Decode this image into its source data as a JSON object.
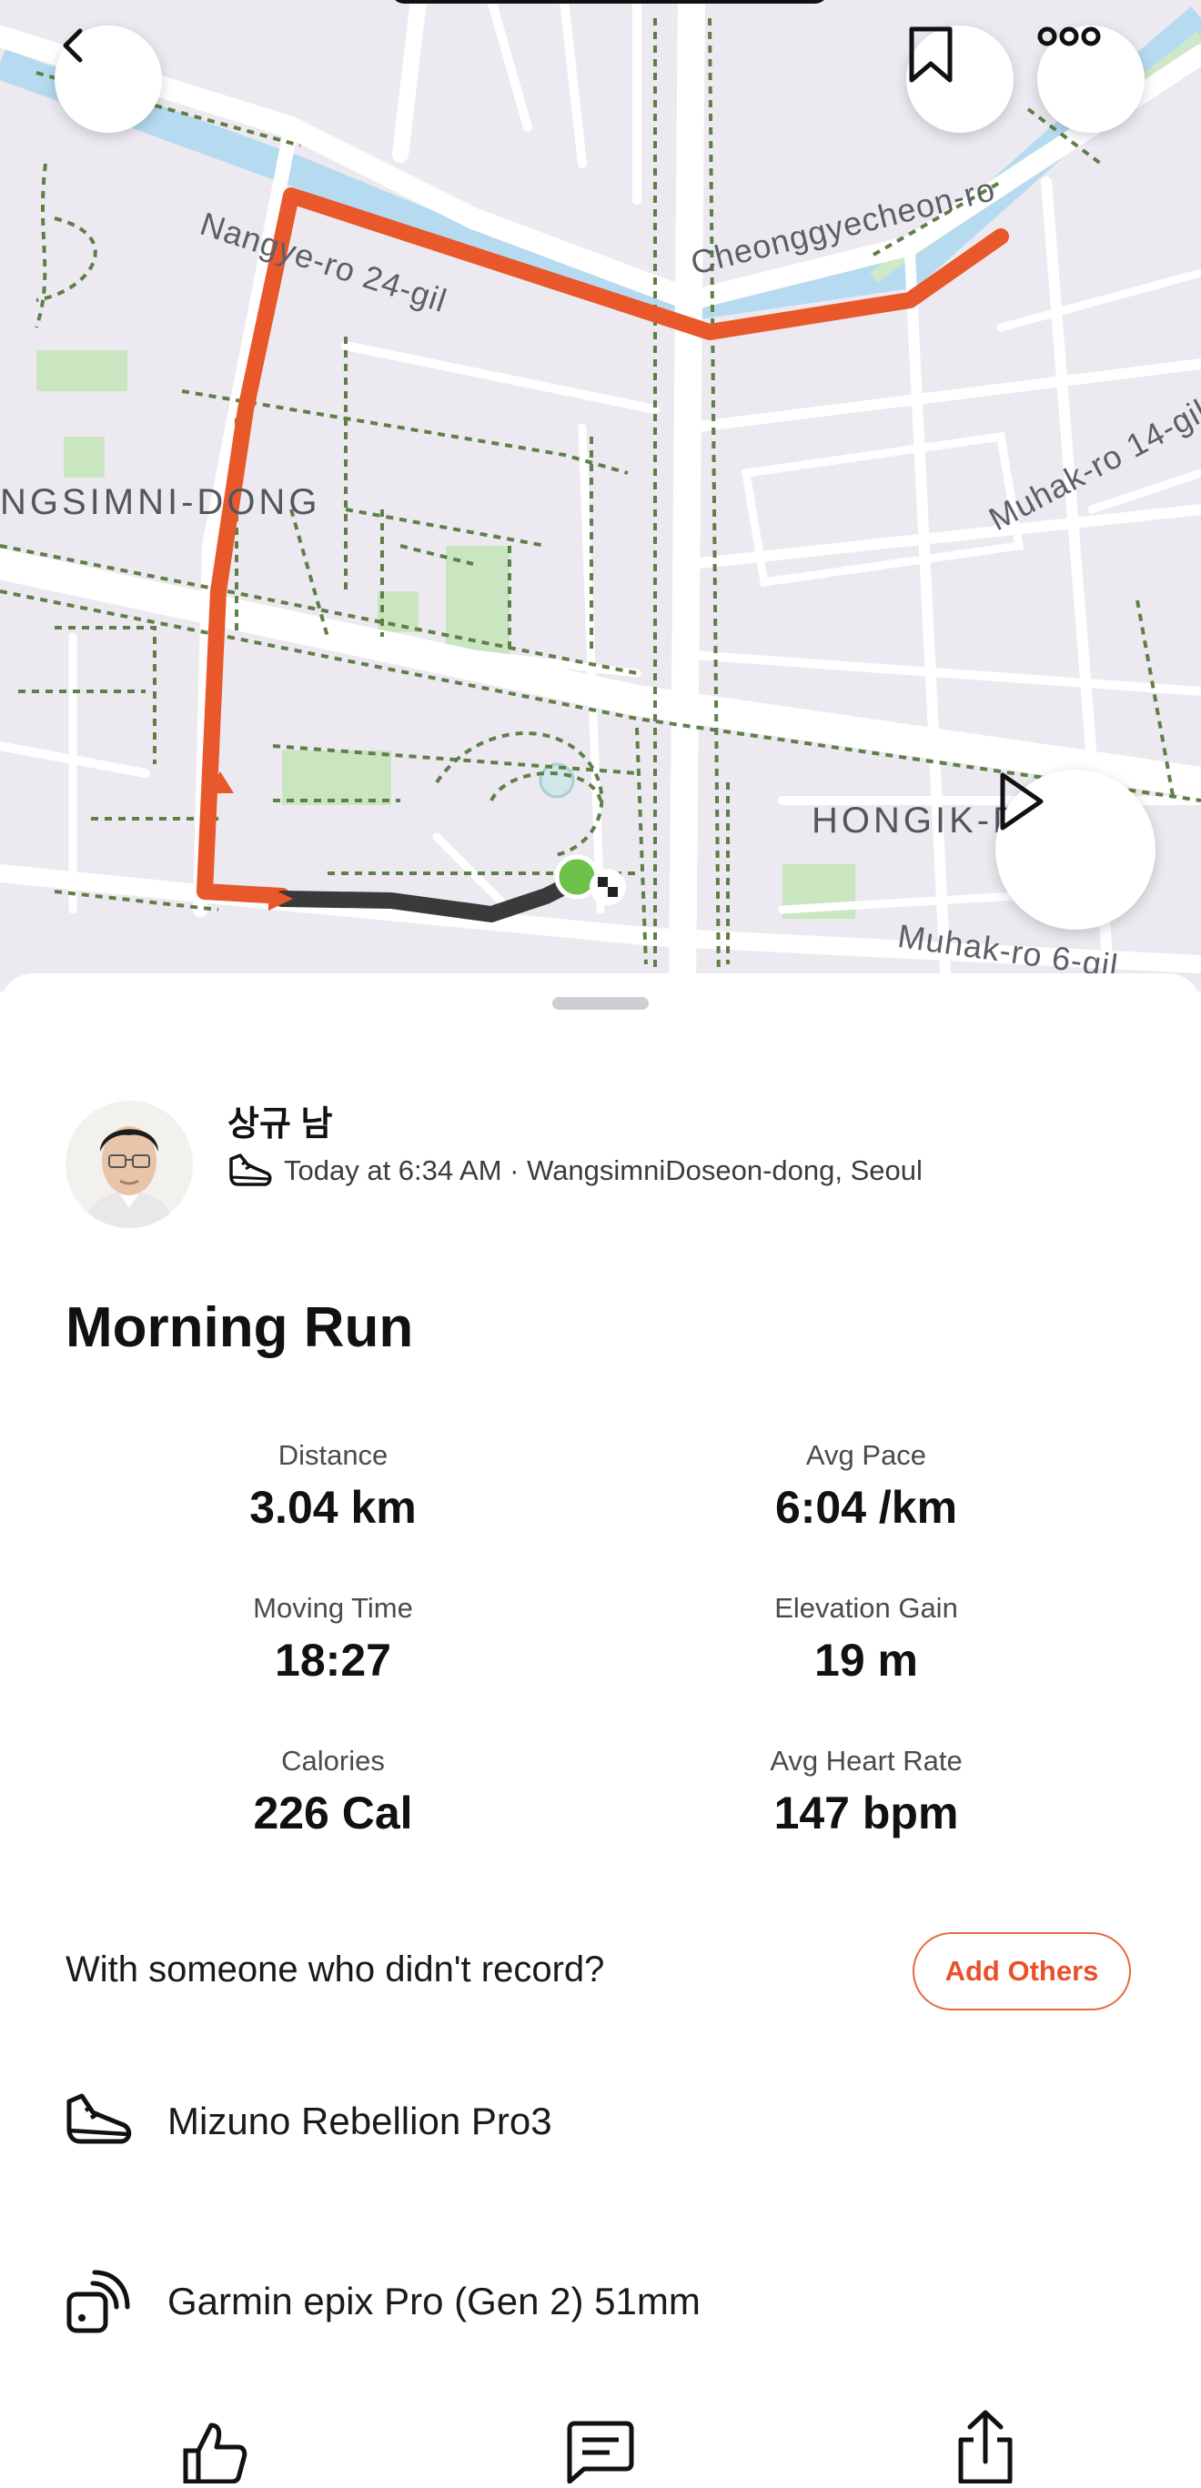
{
  "map": {
    "labels": {
      "road_nangye": "Nangye-ro 24-gil",
      "road_cheonggyecheon": "Cheonggyecheon-ro",
      "district_wangsimni": "NGSIMNI-DONG",
      "road_muhak14": "Muhak-ro 14-gil",
      "district_hongik": "HONGIK-D",
      "road_muhak6": "Muhak-ro 6-gil"
    },
    "route_color": "#e8582a",
    "route_end_color": "#3a3a3a",
    "start_marker_color": "#6cc24a"
  },
  "athlete": {
    "name": "상규 남",
    "meta": "Today at 6:34 AM · WangsimniDoseon-dong, Seoul"
  },
  "activity": {
    "title": "Morning Run",
    "stats": {
      "distance": {
        "label": "Distance",
        "value": "3.04 km"
      },
      "avg_pace": {
        "label": "Avg Pace",
        "value": "6:04 /km"
      },
      "moving_time": {
        "label": "Moving Time",
        "value": "18:27"
      },
      "elevation_gain": {
        "label": "Elevation Gain",
        "value": "19 m"
      },
      "calories": {
        "label": "Calories",
        "value": "226 Cal"
      },
      "avg_heart_rate": {
        "label": "Avg Heart Rate",
        "value": "147 bpm"
      }
    }
  },
  "with_others": {
    "prompt": "With someone who didn't record?",
    "button_label": "Add Others"
  },
  "gear": {
    "shoes": "Mizuno Rebellion Pro3",
    "device": "Garmin epix Pro (Gen 2) 51mm"
  },
  "icons": {
    "back": "chevron-left-icon",
    "bookmark": "bookmark-icon",
    "more": "more-icon",
    "play": "play-icon",
    "shoe": "shoe-icon",
    "device": "watch-icon",
    "kudos": "thumbs-up-icon",
    "comment": "comment-icon",
    "share": "share-icon"
  },
  "colors": {
    "accent": "#e8512a"
  }
}
